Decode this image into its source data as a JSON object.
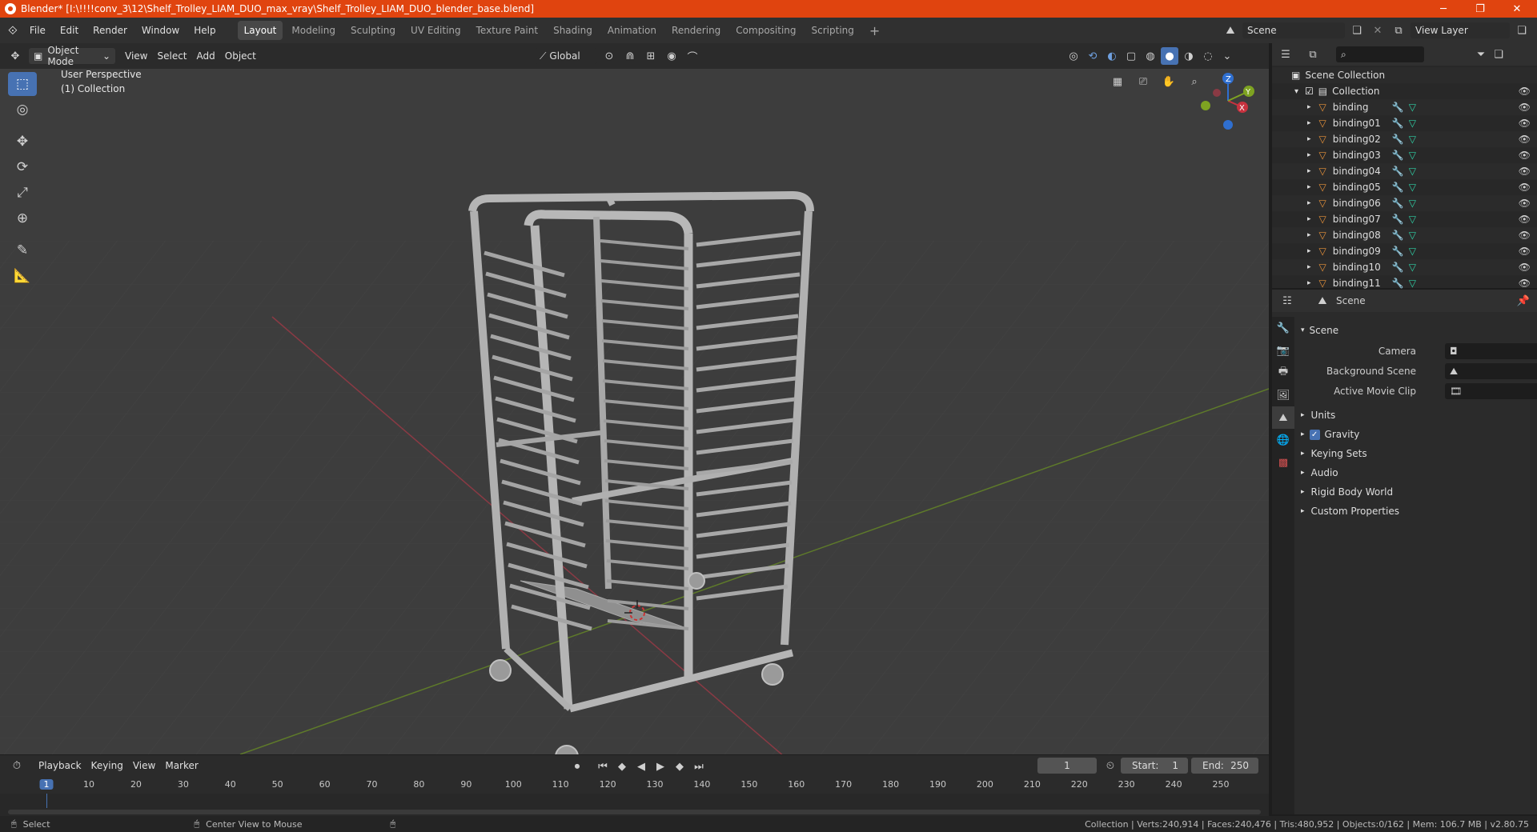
{
  "titlebar": {
    "title": "Blender* [I:\\!!!!conv_3\\12\\Shelf_Trolley_LIAM_DUO_max_vray\\Shelf_Trolley_LIAM_DUO_blender_base.blend]"
  },
  "menus": [
    "File",
    "Edit",
    "Render",
    "Window",
    "Help"
  ],
  "workspaces": [
    "Layout",
    "Modeling",
    "Sculpting",
    "UV Editing",
    "Texture Paint",
    "Shading",
    "Animation",
    "Rendering",
    "Compositing",
    "Scripting"
  ],
  "active_workspace": "Layout",
  "scene_selector": "Scene",
  "view_layer": "View Layer",
  "viewport_header": {
    "mode": "Object Mode",
    "menus": [
      "View",
      "Select",
      "Add",
      "Object"
    ],
    "transform": "Global"
  },
  "viewport": {
    "perspective": "User Perspective",
    "collection": "(1) Collection"
  },
  "gizmo": {
    "x": "X",
    "y": "Y",
    "z": "Z"
  },
  "outliner": {
    "root": "Scene Collection",
    "collection": "Collection",
    "items": [
      "binding",
      "binding01",
      "binding02",
      "binding03",
      "binding04",
      "binding05",
      "binding06",
      "binding07",
      "binding08",
      "binding09",
      "binding10",
      "binding11"
    ]
  },
  "properties": {
    "header": "Scene",
    "panel": "Scene",
    "camera_label": "Camera",
    "background_label": "Background Scene",
    "movieclip_label": "Active Movie Clip",
    "sections": [
      "Units",
      "Gravity",
      "Keying Sets",
      "Audio",
      "Rigid Body World",
      "Custom Properties"
    ]
  },
  "timeline": {
    "menus": [
      "Playback",
      "Keying",
      "View",
      "Marker"
    ],
    "current_frame": "1",
    "start_label": "Start:",
    "start": "1",
    "end_label": "End:",
    "end": "250",
    "ticks": [
      "1",
      "10",
      "20",
      "30",
      "40",
      "50",
      "60",
      "70",
      "80",
      "90",
      "100",
      "110",
      "120",
      "130",
      "140",
      "150",
      "160",
      "170",
      "180",
      "190",
      "200",
      "210",
      "220",
      "230",
      "240",
      "250"
    ]
  },
  "statusbar": {
    "left1": "Select",
    "left2": "Center View to Mouse",
    "stats": "Collection | Verts:240,914 | Faces:240,476 | Tris:480,952 | Objects:0/162 | Mem: 106.7 MB | v2.80.75"
  },
  "colors": {
    "accent": "#4772b3",
    "titlebar": "#e0440f",
    "x_axis": "#c8323f",
    "y_axis": "#7ea321",
    "mesh_icon": "#e8923a",
    "data_icon": "#2fd1a6"
  }
}
